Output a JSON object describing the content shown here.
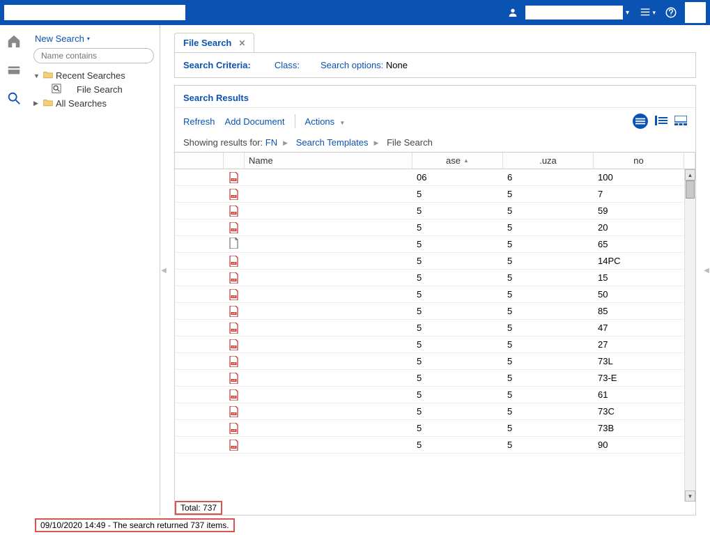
{
  "topbar": {
    "search_value": "",
    "burger_dd": "▾",
    "user_dd": "▾"
  },
  "nav": {
    "new_search": "New Search",
    "name_contains_placeholder": "Name contains",
    "recent_label": "Recent Searches",
    "file_search_item": "File Search",
    "all_searches": "All Searches"
  },
  "tab": {
    "title": "File Search"
  },
  "criteria": {
    "label": "Search Criteria:",
    "class_label": "Class:",
    "class_value": "",
    "opts_label": "Search options:",
    "opts_value": "None"
  },
  "results_title": "Search Results",
  "toolbar": {
    "refresh": "Refresh",
    "add_doc": "Add Document",
    "actions": "Actions"
  },
  "breadcrumbs": {
    "prefix": "Showing results for:",
    "p1": "FN",
    "p2": "Search Templates",
    "p3": "File Search"
  },
  "columns": {
    "name": "Name",
    "ase": "ase",
    "uza": ".uza",
    "no": "no"
  },
  "rows": [
    {
      "icon": "pdf",
      "name": "",
      "ase": "06",
      "uza": "6",
      "no": "100"
    },
    {
      "icon": "pdf",
      "name": "",
      "ase": "5",
      "uza": "5",
      "no": "7"
    },
    {
      "icon": "pdf",
      "name": "",
      "ase": "5",
      "uza": "5",
      "no": "59"
    },
    {
      "icon": "pdf",
      "name": "",
      "ase": "5",
      "uza": "5",
      "no": "20"
    },
    {
      "icon": "blank",
      "name": "",
      "ase": "5",
      "uza": "5",
      "no": "65"
    },
    {
      "icon": "pdf",
      "name": "",
      "ase": "5",
      "uza": "5",
      "no": "14PC"
    },
    {
      "icon": "pdf",
      "name": "",
      "ase": "5",
      "uza": "5",
      "no": "15"
    },
    {
      "icon": "pdf",
      "name": "",
      "ase": "5",
      "uza": "5",
      "no": "50"
    },
    {
      "icon": "pdf",
      "name": "",
      "ase": "5",
      "uza": "5",
      "no": "85"
    },
    {
      "icon": "pdf",
      "name": "",
      "ase": "5",
      "uza": "5",
      "no": "47"
    },
    {
      "icon": "pdf",
      "name": "",
      "ase": "5",
      "uza": "5",
      "no": "27"
    },
    {
      "icon": "pdf",
      "name": "",
      "ase": "5",
      "uza": "5",
      "no": "73L"
    },
    {
      "icon": "pdf",
      "name": "",
      "ase": "5",
      "uza": "5",
      "no": "73-E"
    },
    {
      "icon": "pdf",
      "name": "",
      "ase": "5",
      "uza": "5",
      "no": "61"
    },
    {
      "icon": "pdf",
      "name": "",
      "ase": "5",
      "uza": "5",
      "no": "73C"
    },
    {
      "icon": "pdf",
      "name": "",
      "ase": "5",
      "uza": "5",
      "no": "73B"
    },
    {
      "icon": "pdf",
      "name": "",
      "ase": "5",
      "uza": "5",
      "no": "90"
    }
  ],
  "total": "Total: 737",
  "status": "09/10/2020 14:49 - The search returned 737 items."
}
